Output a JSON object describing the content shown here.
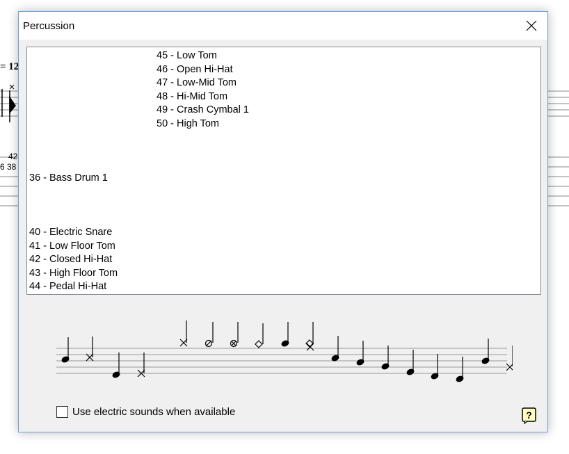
{
  "background": {
    "tempo_text": "= 12",
    "tab_top": "42",
    "tab_bottom": "6 38"
  },
  "dialog": {
    "title": "Percussion",
    "list": {
      "col1_top": [
        "36 - Bass Drum 1"
      ],
      "col1_bottom": [
        "40 - Electric Snare",
        "41 - Low Floor Tom",
        "42 - Closed Hi-Hat",
        "43 - High Floor Tom",
        "44 - Pedal Hi-Hat"
      ],
      "col2": [
        "45 - Low Tom",
        "46 - Open Hi-Hat",
        "47 - Low-Mid Tom",
        "48 - Hi-Mid Tom",
        "49 - Crash Cymbal 1",
        "50 - High Tom"
      ]
    },
    "checkbox": {
      "label": "Use electric sounds when available",
      "checked": false
    },
    "icons": {
      "close": "close-icon",
      "help": "help-icon"
    }
  }
}
